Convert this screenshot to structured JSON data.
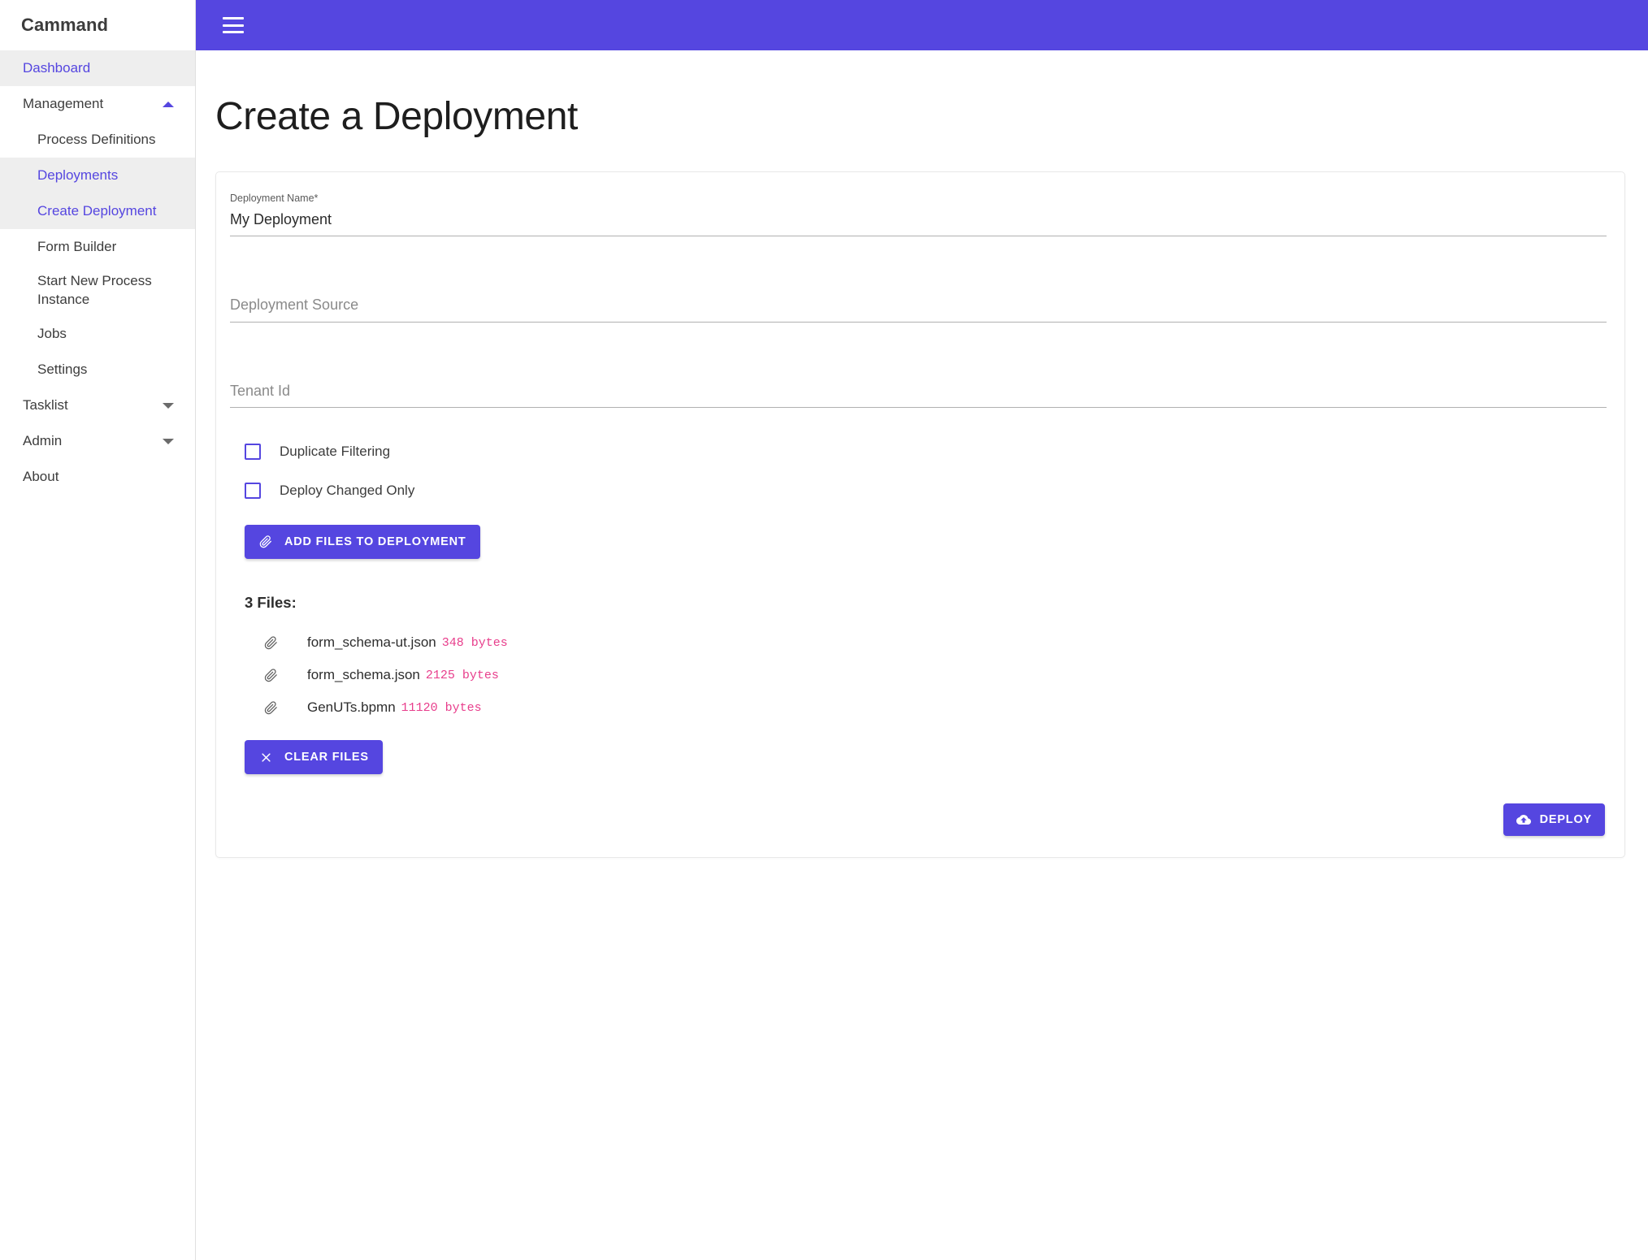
{
  "brand": {
    "name": "Cammand"
  },
  "topbar": {
    "menu_icon": "hamburger-menu-icon"
  },
  "sidebar": {
    "items": [
      {
        "label": "Dashboard",
        "level": "top",
        "state": "highlighted",
        "color": "accent",
        "caret": "none"
      },
      {
        "label": "Management",
        "level": "top",
        "state": "expanded",
        "color": "default",
        "caret": "up"
      },
      {
        "label": "Process Definitions",
        "level": "sub",
        "state": "normal",
        "color": "default",
        "caret": "none"
      },
      {
        "label": "Deployments",
        "level": "sub",
        "state": "highlighted",
        "color": "accent",
        "caret": "none"
      },
      {
        "label": "Create Deployment",
        "level": "sub",
        "state": "highlighted",
        "color": "accent",
        "caret": "none"
      },
      {
        "label": "Form Builder",
        "level": "sub",
        "state": "normal",
        "color": "default",
        "caret": "none"
      },
      {
        "label": "Start New Process Instance",
        "level": "sub",
        "state": "normal",
        "color": "default",
        "caret": "none"
      },
      {
        "label": "Jobs",
        "level": "sub",
        "state": "normal",
        "color": "default",
        "caret": "none"
      },
      {
        "label": "Settings",
        "level": "sub",
        "state": "normal",
        "color": "default",
        "caret": "none"
      },
      {
        "label": "Tasklist",
        "level": "top",
        "state": "collapsed",
        "color": "default",
        "caret": "down"
      },
      {
        "label": "Admin",
        "level": "top",
        "state": "collapsed",
        "color": "default",
        "caret": "down"
      },
      {
        "label": "About",
        "level": "top",
        "state": "normal",
        "color": "default",
        "caret": "none"
      }
    ]
  },
  "page": {
    "title": "Create a Deployment"
  },
  "form": {
    "deployment_name": {
      "label": "Deployment Name*",
      "value": "My Deployment"
    },
    "deployment_source": {
      "placeholder": "Deployment Source",
      "value": ""
    },
    "tenant_id": {
      "placeholder": "Tenant Id",
      "value": ""
    },
    "checkboxes": [
      {
        "label": "Duplicate Filtering",
        "checked": false
      },
      {
        "label": "Deploy Changed Only",
        "checked": false
      }
    ],
    "add_files_button": {
      "label": "ADD FILES TO DEPLOYMENT",
      "icon": "paperclip-icon"
    },
    "clear_files_button": {
      "label": "CLEAR FILES",
      "icon": "close-x-icon"
    },
    "deploy_button": {
      "label": "DEPLOY",
      "icon": "cloud-upload-icon"
    }
  },
  "files": {
    "heading": "3 Files:",
    "count": 3,
    "items": [
      {
        "name": "form_schema-ut.json",
        "size": "348 bytes",
        "icon": "paperclip-icon"
      },
      {
        "name": "form_schema.json",
        "size": "2125 bytes",
        "icon": "paperclip-icon"
      },
      {
        "name": "GenUTs.bpmn",
        "size": "11120 bytes",
        "icon": "paperclip-icon"
      }
    ]
  },
  "colors": {
    "primary": "#5546e0",
    "sidebar_highlight": "#eeeeee",
    "file_size": "#e83e8c",
    "text": "#2d2d2d",
    "muted": "#8a8a8a"
  }
}
